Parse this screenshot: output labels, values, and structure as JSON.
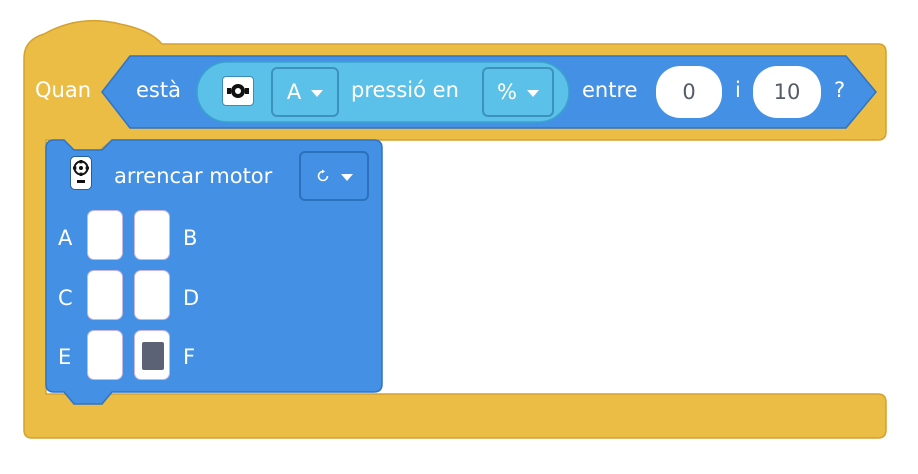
{
  "hat_block": {
    "label": "Quan",
    "color": "#ebbd45",
    "condition": {
      "prefix": "està",
      "sensor_icon": "force-sensor-icon",
      "port_value": "A",
      "measure_label": "pressió en",
      "unit_value": "%",
      "between_label": "entre",
      "low_value": "0",
      "and_label": "i",
      "high_value": "10",
      "question": "?",
      "color": "#4390e5",
      "inner_color": "#5cc1e8"
    }
  },
  "motor_block": {
    "icon": "motor-icon",
    "label": "arrencar motor",
    "direction_icon": "clockwise-icon",
    "color": "#4390e5",
    "ports": [
      {
        "left": "A",
        "right": "B",
        "left_on": false,
        "right_on": false
      },
      {
        "left": "C",
        "right": "D",
        "left_on": false,
        "right_on": false
      },
      {
        "left": "E",
        "right": "F",
        "left_on": false,
        "right_on": true
      }
    ]
  }
}
